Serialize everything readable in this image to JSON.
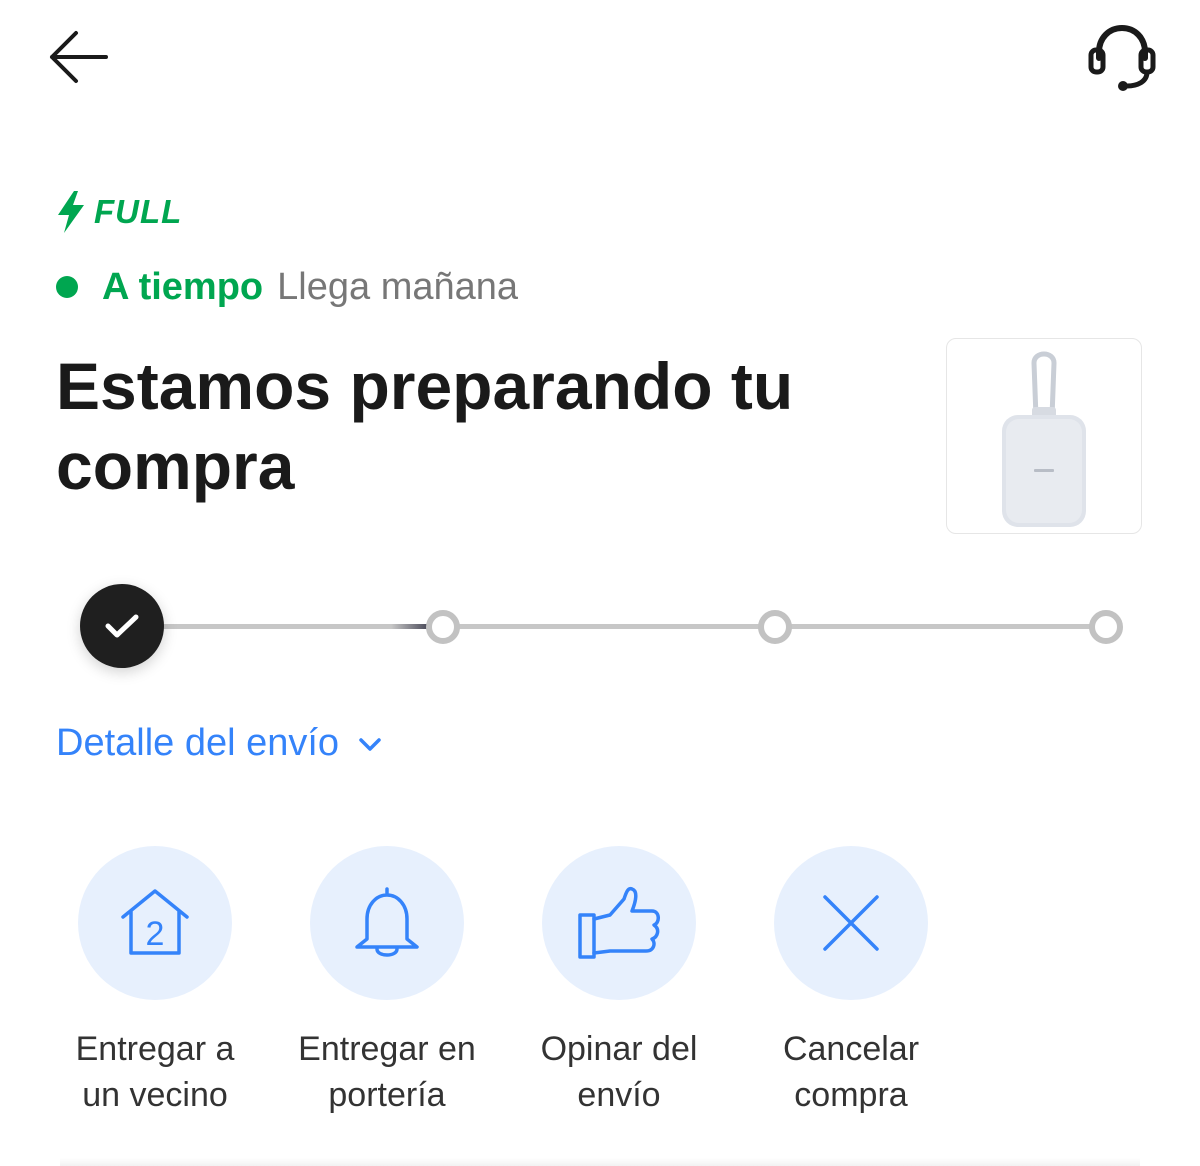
{
  "topbar": {
    "back_icon": "arrow-left-icon",
    "help_icon": "headset-icon"
  },
  "badge": {
    "text": "FULL",
    "icon": "lightning-bolt-icon",
    "color": "#00a650"
  },
  "status": {
    "label": "A tiempo",
    "detail": "Llega mañana",
    "color": "#00a650"
  },
  "title": "Estamos preparando tu compra",
  "product": {
    "image_icon": "power-bank-image"
  },
  "progress": {
    "total_steps": 4,
    "completed_steps": 1
  },
  "shipping_detail": {
    "label": "Detalle del envío",
    "icon": "chevron-down-icon",
    "color": "#3483fa"
  },
  "actions": [
    {
      "icon": "house-2-icon",
      "label": "Entregar a\nun vecino"
    },
    {
      "icon": "bell-icon",
      "label": "Entregar en\nportería"
    },
    {
      "icon": "thumbs-up-icon",
      "label": "Opinar del\nenvío"
    },
    {
      "icon": "close-icon",
      "label": "Cancelar\ncompra"
    }
  ],
  "colors": {
    "accent": "#3483fa",
    "action_bg": "#e7f0fd",
    "text": "#1a1a1a"
  }
}
